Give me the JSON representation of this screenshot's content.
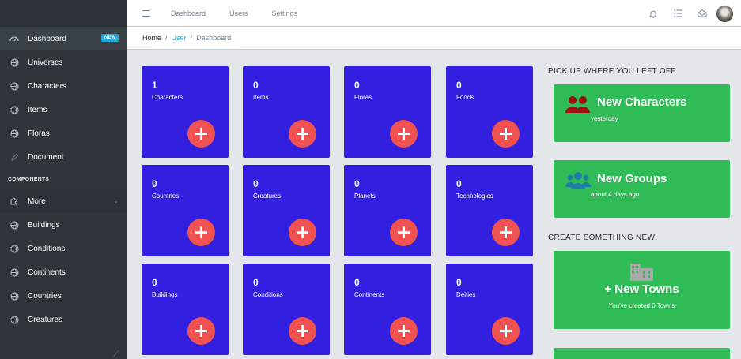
{
  "sidebar": {
    "items": [
      {
        "label": "Dashboard",
        "badge": "NEW",
        "icon": "speedometer-icon"
      },
      {
        "label": "Universes",
        "icon": "globe-icon"
      },
      {
        "label": "Characters",
        "icon": "globe-icon"
      },
      {
        "label": "Items",
        "icon": "globe-icon"
      },
      {
        "label": "Floras",
        "icon": "globe-icon"
      },
      {
        "label": "Document",
        "icon": "pencil-icon"
      }
    ],
    "section_title": "COMPONENTS",
    "components": [
      {
        "label": "More",
        "icon": "puzzle-icon"
      },
      {
        "label": "Buildings",
        "icon": "globe-icon"
      },
      {
        "label": "Conditions",
        "icon": "globe-icon"
      },
      {
        "label": "Continents",
        "icon": "globe-icon"
      },
      {
        "label": "Countries",
        "icon": "globe-icon"
      },
      {
        "label": "Creatures",
        "icon": "globe-icon"
      }
    ]
  },
  "header": {
    "nav": [
      "Dashboard",
      "Users",
      "Settings"
    ]
  },
  "breadcrumb": {
    "home": "Home",
    "user": "User",
    "current": "Dashboard",
    "separator": "/"
  },
  "cards": [
    {
      "count": "1",
      "label": "Characters"
    },
    {
      "count": "0",
      "label": "Items"
    },
    {
      "count": "0",
      "label": "Floras"
    },
    {
      "count": "0",
      "label": "Foods"
    },
    {
      "count": "0",
      "label": "Countries"
    },
    {
      "count": "0",
      "label": "Creatures"
    },
    {
      "count": "0",
      "label": "Planets"
    },
    {
      "count": "0",
      "label": "Technologies"
    },
    {
      "count": "0",
      "label": "Buildings"
    },
    {
      "count": "0",
      "label": "Conditions"
    },
    {
      "count": "0",
      "label": "Continents"
    },
    {
      "count": "0",
      "label": "Deities"
    }
  ],
  "right": {
    "pickup_title": "PICK UP WHERE YOU LEFT OFF",
    "recent": [
      {
        "title": "New Characters",
        "time": "yesterday"
      },
      {
        "title": "New Groups",
        "time": "about 4 days ago"
      }
    ],
    "create_title": "CREATE SOMETHING NEW",
    "create": {
      "title": "New Towns",
      "plus": "+",
      "sub": "You've created 0 Towns"
    }
  },
  "colors": {
    "sidebar": "#2f353a",
    "card": "#331fdf",
    "add_button": "#f05151",
    "green": "#2fbc57",
    "badge": "#20a8d8"
  }
}
